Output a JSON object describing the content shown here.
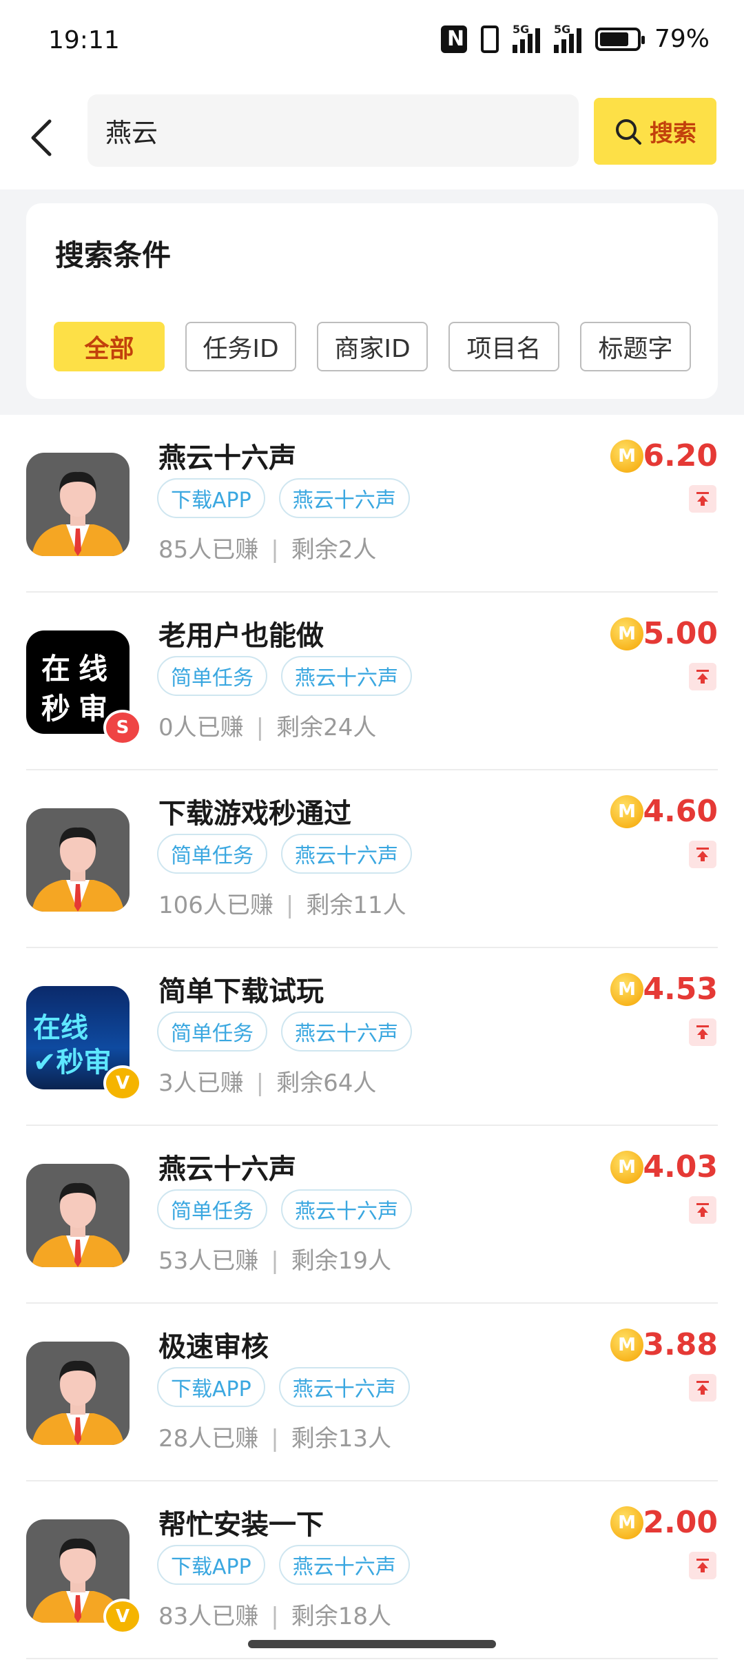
{
  "status_bar": {
    "time": "19:11",
    "battery": "79%",
    "network_1": "5G",
    "network_2": "5G",
    "battery_level": 0.79
  },
  "search": {
    "query": "燕云",
    "button_label": "搜索"
  },
  "filter": {
    "title": "搜索条件",
    "options": [
      "全部",
      "任务ID",
      "商家ID",
      "项目名",
      "标题字"
    ],
    "selected": "全部"
  },
  "tasks": [
    {
      "title": "燕云十六声",
      "tags": [
        "下载APP",
        "燕云十六声"
      ],
      "earned": "85人已赚",
      "remaining": "剩余2人",
      "price": "6.20",
      "avatar": "person-avatar",
      "badge": ""
    },
    {
      "title": "老用户也能做",
      "tags": [
        "简单任务",
        "燕云十六声"
      ],
      "earned": "0人已赚",
      "remaining": "剩余24人",
      "price": "5.00",
      "avatar": "text-logo-black",
      "avatar_text": [
        "在线",
        "秒审"
      ],
      "badge": "S"
    },
    {
      "title": "下载游戏秒通过",
      "tags": [
        "简单任务",
        "燕云十六声"
      ],
      "earned": "106人已赚",
      "remaining": "剩余11人",
      "price": "4.60",
      "avatar": "person-avatar",
      "badge": ""
    },
    {
      "title": "简单下载试玩",
      "tags": [
        "简单任务",
        "燕云十六声"
      ],
      "earned": "3人已赚",
      "remaining": "剩余64人",
      "price": "4.53",
      "avatar": "text-logo-blue",
      "avatar_text": [
        "在线",
        "✔秒审"
      ],
      "badge": "V"
    },
    {
      "title": "燕云十六声",
      "tags": [
        "简单任务",
        "燕云十六声"
      ],
      "earned": "53人已赚",
      "remaining": "剩余19人",
      "price": "4.03",
      "avatar": "person-avatar",
      "badge": ""
    },
    {
      "title": "极速审核",
      "tags": [
        "下载APP",
        "燕云十六声"
      ],
      "earned": "28人已赚",
      "remaining": "剩余13人",
      "price": "3.88",
      "avatar": "person-avatar",
      "badge": ""
    },
    {
      "title": "帮忙安装一下",
      "tags": [
        "下载APP",
        "燕云十六声"
      ],
      "earned": "83人已赚",
      "remaining": "剩余18人",
      "price": "2.00",
      "avatar": "person-avatar",
      "badge": "V"
    }
  ],
  "separator": "|",
  "coin_label": "M",
  "colors": {
    "accent": "#fde047",
    "price": "#e53935",
    "tag": "#3aa7e0"
  }
}
